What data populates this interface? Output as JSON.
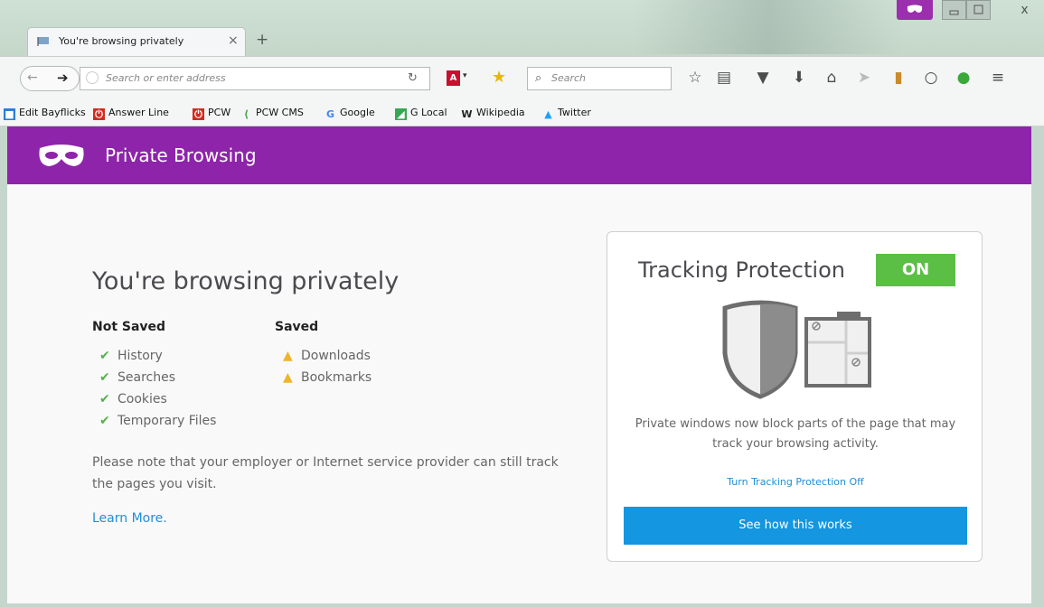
{
  "window": {
    "tab_title": "You're browsing privately",
    "tab_close": "×",
    "new_tab": "+",
    "close_button": "x"
  },
  "navbar": {
    "address_placeholder": "Search or enter address",
    "search_placeholder": "Search",
    "pdf_label": "A"
  },
  "bookmarks": [
    {
      "label": "Edit Bayflicks",
      "icon": "blue-square-icon",
      "color": "#2a7fd4"
    },
    {
      "label": "Answer Line",
      "icon": "pcw-red-icon",
      "color": "#d52b1e"
    },
    {
      "label": "PCW",
      "icon": "pcw-red-icon",
      "color": "#d52b1e"
    },
    {
      "label": "PCW CMS",
      "icon": "pcw-cms-icon",
      "color": "#3a9a3a"
    },
    {
      "label": "Google",
      "icon": "google-g-icon",
      "color": "#4285f4"
    },
    {
      "label": "G Local",
      "icon": "maps-icon",
      "color": "#34a853"
    },
    {
      "label": "Wikipedia",
      "icon": "wikipedia-w-icon",
      "color": "#222222"
    },
    {
      "label": "Twitter",
      "icon": "twitter-bird-icon",
      "color": "#1da1f2"
    }
  ],
  "header": {
    "title": "Private Browsing",
    "color": "#8e24aa"
  },
  "main": {
    "heading": "You're browsing privately",
    "not_saved_title": "Not Saved",
    "not_saved_items": [
      "History",
      "Searches",
      "Cookies",
      "Temporary Files"
    ],
    "saved_title": "Saved",
    "saved_items": [
      "Downloads",
      "Bookmarks"
    ],
    "note": "Please note that your employer or Internet service provider can still track the pages you visit.",
    "learn_more": "Learn More."
  },
  "tracking": {
    "title": "Tracking Protection",
    "status": "ON",
    "description": "Private windows now block parts of the page that may track your browsing activity.",
    "toggle_link": "Turn Tracking Protection Off",
    "button": "See how this works",
    "on_color": "#5bbf45",
    "button_color": "#1496e0"
  }
}
